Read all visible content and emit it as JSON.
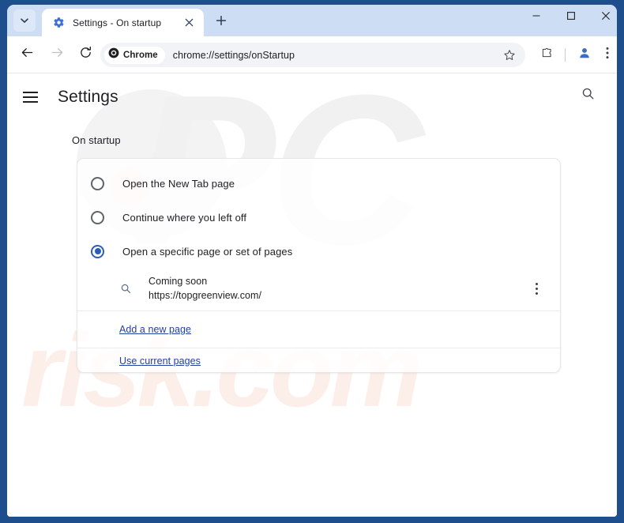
{
  "window": {
    "frame_color": "#1f4e8c",
    "controls": {
      "minimize": "minimize-button",
      "maximize": "maximize-button",
      "close": "close-button"
    }
  },
  "tabstrip": {
    "tab_search_icon": "chevron-down-icon",
    "tabs": [
      {
        "title": "Settings - On startup",
        "favicon": "gear-icon",
        "close_icon": "close-icon",
        "active": true
      }
    ],
    "new_tab_icon": "plus-icon"
  },
  "toolbar": {
    "back_icon": "arrow-left-icon",
    "forward_icon": "arrow-right-icon",
    "reload_icon": "reload-icon",
    "omnibox": {
      "chip_label": "Chrome",
      "chip_icon": "chrome-logo-icon",
      "url": "chrome://settings/onStartup",
      "bookmark_icon": "star-icon"
    },
    "extensions_icon": "puzzle-piece-icon",
    "profile_icon": "avatar-icon",
    "menu_icon": "three-dot-vertical-icon"
  },
  "settings": {
    "menu_icon": "hamburger-icon",
    "title": "Settings",
    "search_icon": "search-icon",
    "section_label": "On startup",
    "options": [
      {
        "label": "Open the New Tab page",
        "checked": false
      },
      {
        "label": "Continue where you left off",
        "checked": false
      },
      {
        "label": "Open a specific page or set of pages",
        "checked": true
      }
    ],
    "startup_pages": [
      {
        "icon": "search-icon",
        "title": "Coming soon",
        "url": "https://topgreenview.com/",
        "menu_icon": "three-dot-vertical-icon"
      }
    ],
    "add_page_link": "Add a new page",
    "use_current_pages_link": "Use current pages",
    "link_color": "#23419e",
    "accent_color": "#2b5cb8"
  },
  "watermarks": {
    "primary": "PC",
    "secondary": "risk.com"
  }
}
